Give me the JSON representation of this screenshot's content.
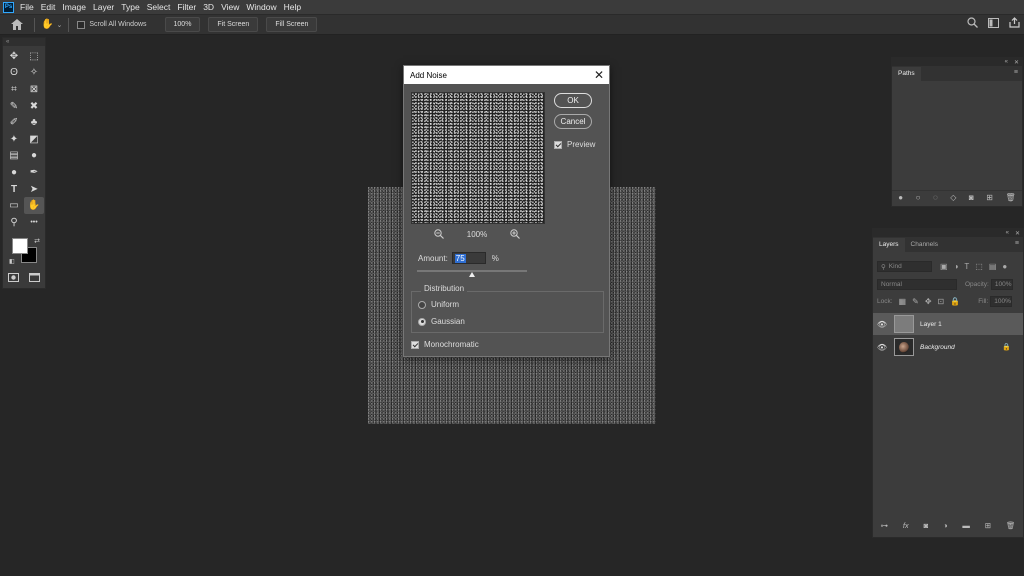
{
  "menubar": {
    "logo": "Ps",
    "items": [
      "File",
      "Edit",
      "Image",
      "Layer",
      "Type",
      "Select",
      "Filter",
      "3D",
      "View",
      "Window",
      "Help"
    ]
  },
  "optionsbar": {
    "scroll_all_label": "Scroll All Windows",
    "zoom_button": "100%",
    "fit_screen": "Fit Screen",
    "fill_screen": "Fill Screen"
  },
  "toolbar": {
    "collapse": "«",
    "tools": [
      {
        "icon": "move-icon",
        "glyph": "✥"
      },
      {
        "icon": "marquee-icon",
        "glyph": "⬚"
      },
      {
        "icon": "lasso-icon",
        "glyph": "ʘ"
      },
      {
        "icon": "magic-wand-icon",
        "glyph": "✧"
      },
      {
        "icon": "crop-icon",
        "glyph": "⌗"
      },
      {
        "icon": "frame-icon",
        "glyph": "⊠"
      },
      {
        "icon": "eyedropper-icon",
        "glyph": "✎"
      },
      {
        "icon": "healing-brush-icon",
        "glyph": "✖"
      },
      {
        "icon": "brush-icon",
        "glyph": "✐"
      },
      {
        "icon": "stamp-icon",
        "glyph": "♣"
      },
      {
        "icon": "history-brush-icon",
        "glyph": "✦"
      },
      {
        "icon": "eraser-icon",
        "glyph": "◩"
      },
      {
        "icon": "gradient-icon",
        "glyph": "▤"
      },
      {
        "icon": "blur-icon",
        "glyph": "●"
      },
      {
        "icon": "dodge-icon",
        "glyph": "●"
      },
      {
        "icon": "pen-icon",
        "glyph": "✒"
      },
      {
        "icon": "type-icon",
        "glyph": "T"
      },
      {
        "icon": "path-selection-icon",
        "glyph": "➤"
      },
      {
        "icon": "rectangle-icon",
        "glyph": "▭"
      },
      {
        "icon": "hand-icon",
        "glyph": "✋"
      },
      {
        "icon": "zoom-icon",
        "glyph": "⚲"
      },
      {
        "icon": "more-tools-icon",
        "glyph": "•••"
      }
    ]
  },
  "dialog": {
    "title": "Add Noise",
    "close": "✕",
    "ok_label": "OK",
    "cancel_label": "Cancel",
    "preview_label": "Preview",
    "zoom_level": "100%",
    "amount_label": "Amount:",
    "amount_value": "75",
    "amount_unit": "%",
    "amount_slider_fraction": 0.5,
    "distribution_label": "Distribution",
    "uniform_label": "Uniform",
    "gaussian_label": "Gaussian",
    "monochromatic_label": "Monochromatic"
  },
  "paths_panel": {
    "tab": "Paths",
    "collapse": "«",
    "close": "✕",
    "menu": "≡"
  },
  "layers_panel": {
    "tabs": [
      "Layers",
      "Channels"
    ],
    "collapse": "«",
    "close": "✕",
    "menu": "≡",
    "kind_placeholder": "Kind",
    "blend_mode": "Normal",
    "opacity_label": "Opacity:",
    "opacity_value": "100%",
    "lock_label": "Lock:",
    "fill_label": "Fill:",
    "fill_value": "100%",
    "layers": [
      {
        "name": "Layer 1",
        "selected": true
      },
      {
        "name": "Background",
        "selected": false,
        "locked": true
      }
    ]
  }
}
